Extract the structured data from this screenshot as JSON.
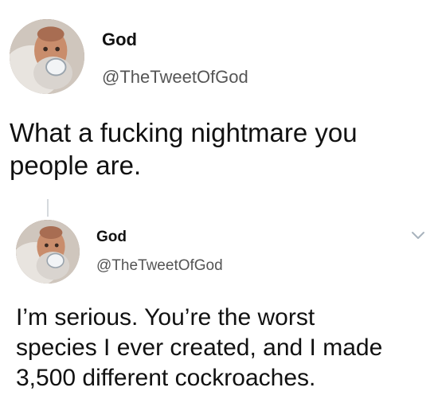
{
  "tweets": [
    {
      "author": {
        "name": "God",
        "handle": "@TheTweetOfGod",
        "avatar_icon": "god-avatar"
      },
      "text_lines": [
        "What a fucking nightmare you",
        "people are."
      ]
    },
    {
      "author": {
        "name": "God",
        "handle": "@TheTweetOfGod",
        "avatar_icon": "god-avatar"
      },
      "text_lines": [
        "I’m serious. You’re the worst",
        "species I ever created, and I made",
        "3,500 different cockroaches."
      ],
      "menu_icon": "chevron-down-icon"
    }
  ],
  "colors": {
    "text": "#111111",
    "handle": "#555555",
    "thread_line": "#d5d9dd",
    "chevron": "#a8b3bd"
  }
}
